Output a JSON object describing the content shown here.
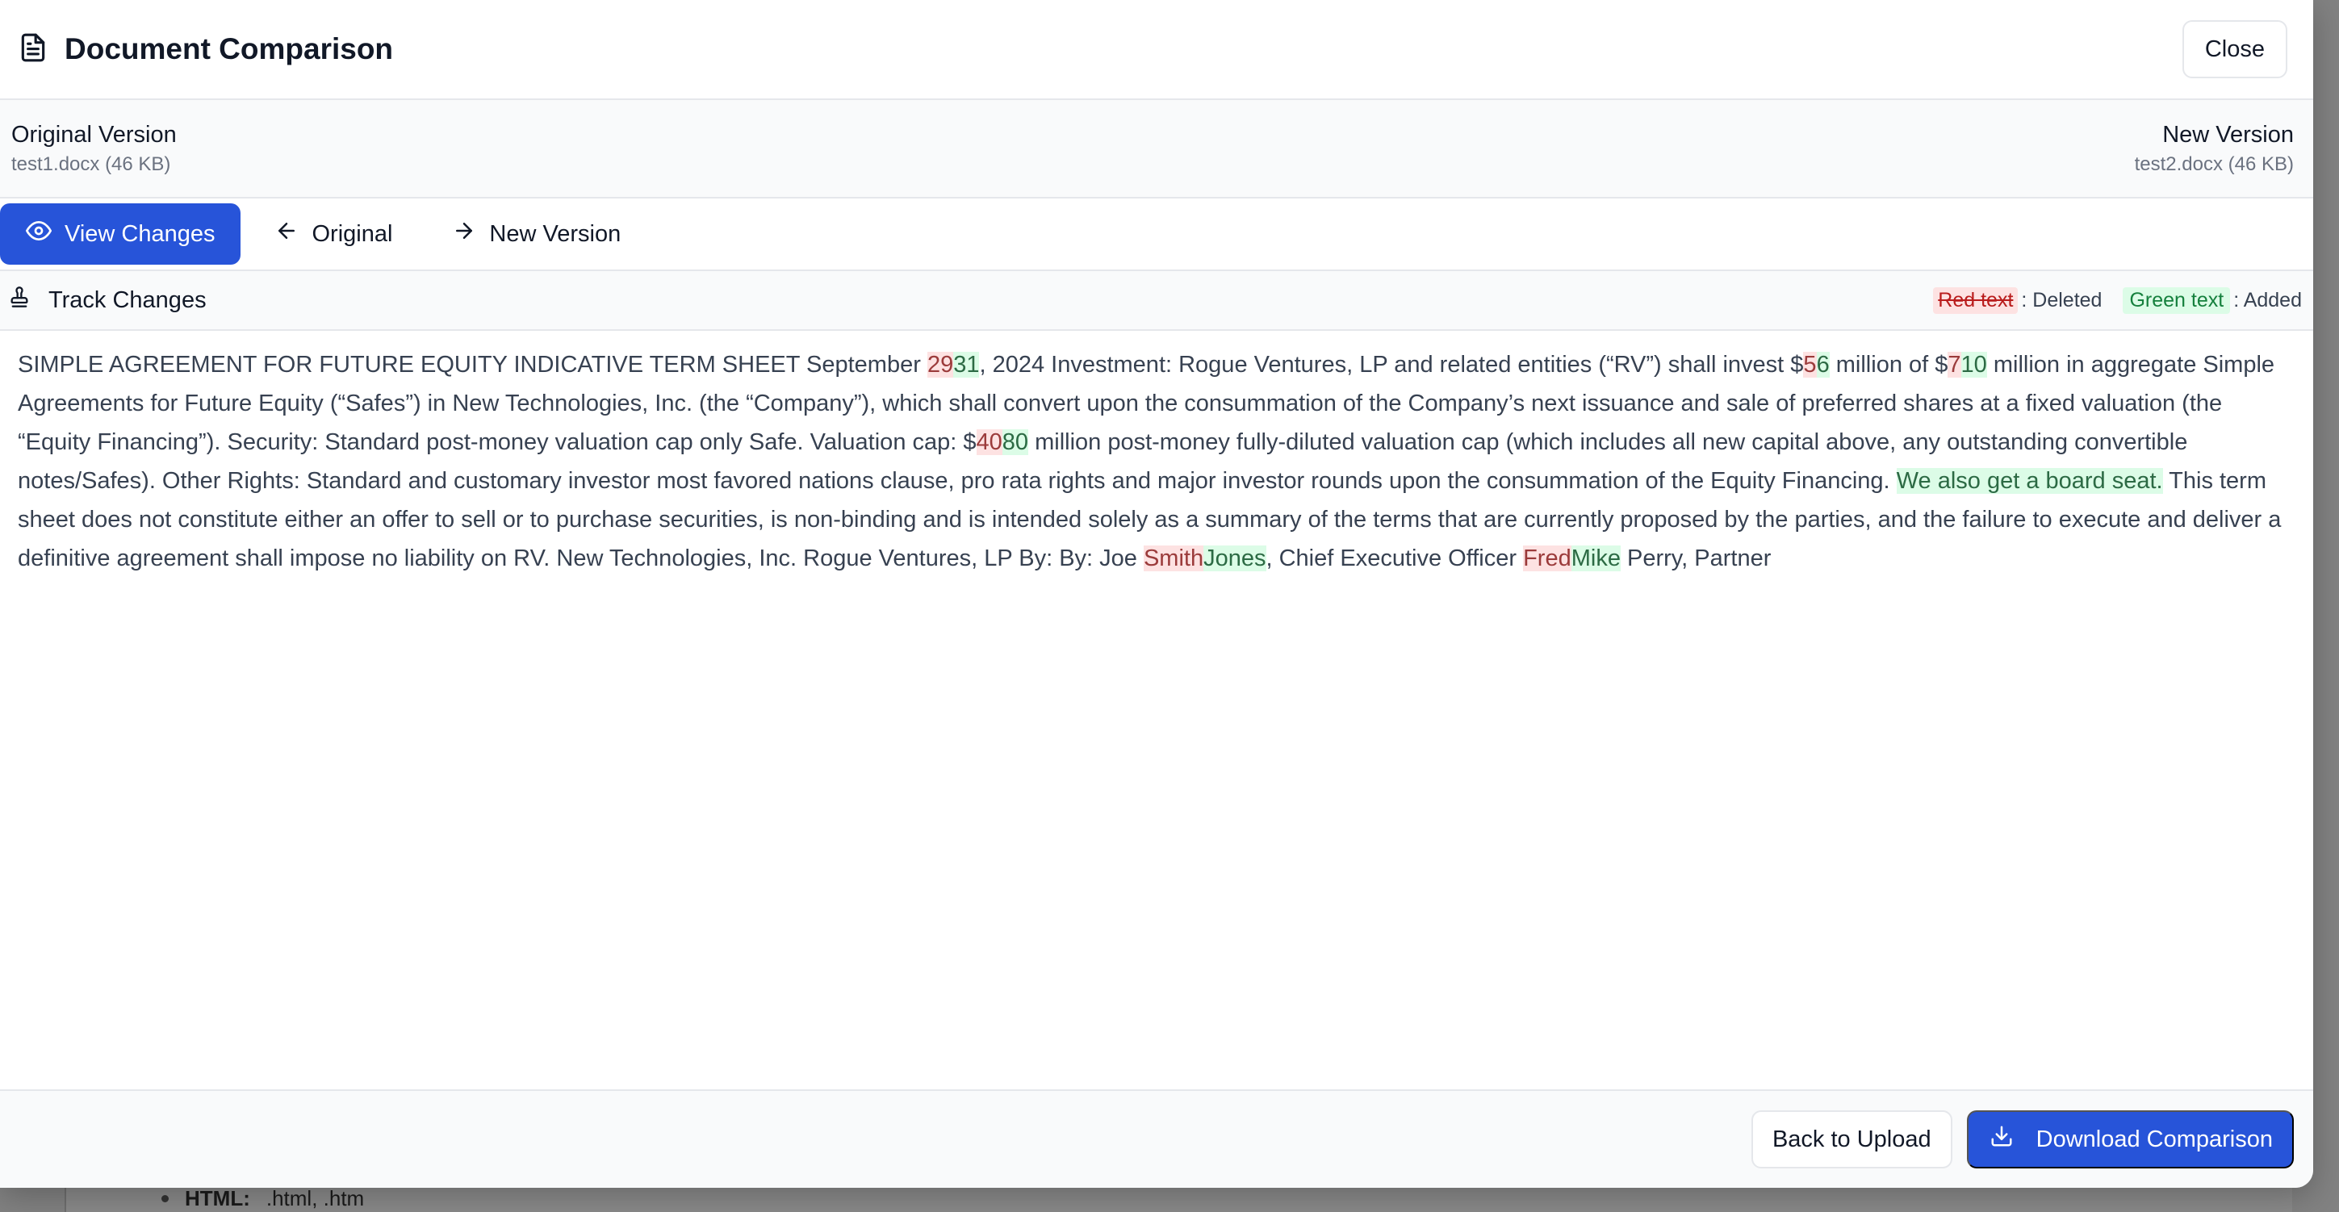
{
  "background": {
    "bullet_label": "HTML:",
    "bullet_value": ".html, .htm"
  },
  "header": {
    "title": "Document Comparison",
    "close_label": "Close"
  },
  "versions": {
    "original": {
      "title": "Original Version",
      "file": "test1.docx (46 KB)"
    },
    "new": {
      "title": "New Version",
      "file": "test2.docx (46 KB)"
    }
  },
  "tabs": [
    {
      "label": "View Changes",
      "active": true
    },
    {
      "label": "Original",
      "active": false
    },
    {
      "label": "New Version",
      "active": false
    }
  ],
  "track": {
    "title": "Track Changes",
    "legend_deleted_sample": "Red text",
    "legend_deleted_desc": ": Deleted",
    "legend_added_sample": "Green text",
    "legend_added_desc": ": Added"
  },
  "document": {
    "segments": [
      {
        "t": "SIMPLE AGREEMENT FOR FUTURE EQUITY INDICATIVE TERM SHEET September "
      },
      {
        "t": "29",
        "type": "del"
      },
      {
        "t": "31",
        "type": "add"
      },
      {
        "t": ", 2024 Investment: Rogue Ventures, LP and related entities (“RV”) shall invest $"
      },
      {
        "t": "5",
        "type": "del"
      },
      {
        "t": "6",
        "type": "add"
      },
      {
        "t": " million of $"
      },
      {
        "t": "7",
        "type": "del"
      },
      {
        "t": "10",
        "type": "add"
      },
      {
        "t": " million in aggregate Simple Agreements for Future Equity (“Safes”) in New Technologies, Inc.  (the “Company”), which shall convert upon the consummation of the Company’s next issuance and sale of preferred shares at a fixed valuation (the “Equity Financing”). Security: Standard post-money valuation cap only Safe. Valuation cap: $"
      },
      {
        "t": "40",
        "type": "del"
      },
      {
        "t": "80",
        "type": "add"
      },
      {
        "t": " million post-money fully-diluted valuation cap (which includes all new capital above, any outstanding convertible notes/Safes). Other Rights: Standard and customary investor most favored nations clause, pro rata rights and major investor rounds upon the consummation of the Equity Financing. "
      },
      {
        "t": "We also get a board seat.",
        "type": "add"
      },
      {
        "t": " This term sheet does not constitute either an offer to sell or to purchase securities, is non-binding and is intended solely as a summary of the terms that are currently proposed by the parties, and the failure to execute and deliver a definitive agreement shall impose no liability on RV. New Technologies, Inc.  Rogue Ventures, LP By: By: Joe "
      },
      {
        "t": "Smith",
        "type": "del"
      },
      {
        "t": "Jones",
        "type": "add"
      },
      {
        "t": ", Chief Executive Officer "
      },
      {
        "t": "Fred",
        "type": "del"
      },
      {
        "t": "Mike",
        "type": "add"
      },
      {
        "t": " Perry, Partner"
      }
    ]
  },
  "footer": {
    "back_label": "Back to Upload",
    "download_label": "Download Comparison"
  },
  "colors": {
    "primary": "#2754d9",
    "deleted_bg": "#fde2e2",
    "added_bg": "#dcfce7"
  }
}
